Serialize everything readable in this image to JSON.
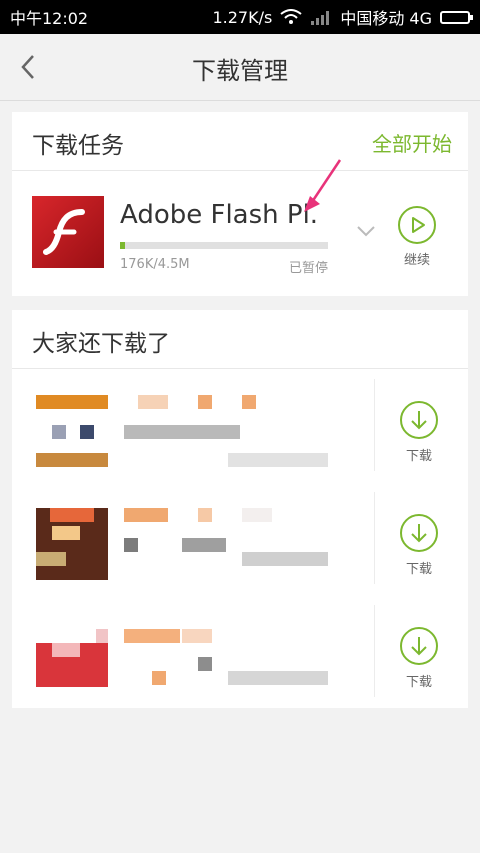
{
  "status_bar": {
    "time": "中午12:02",
    "speed": "1.27K/s",
    "carrier": "中国移动 4G"
  },
  "nav": {
    "title": "下载管理"
  },
  "download_tasks": {
    "title": "下载任务",
    "start_all": "全部开始",
    "items": [
      {
        "name": "Adobe Flash Pl.",
        "size": "176K/4.5M",
        "status": "已暂停",
        "action": "继续",
        "progress": 0.02
      }
    ]
  },
  "recommended": {
    "title": "大家还下载了",
    "items": [
      {
        "action": "下载"
      },
      {
        "action": "下载"
      },
      {
        "action": "下载"
      }
    ]
  },
  "colors": {
    "accent": "#7cb82f",
    "annotation": "#e8337a"
  }
}
